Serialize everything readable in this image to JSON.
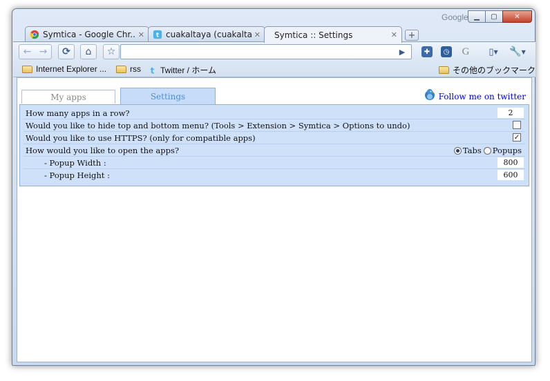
{
  "window": {
    "brand": "Google"
  },
  "tabs": [
    {
      "title": "Symtica - Google Chr...",
      "icon": "chrome-icon"
    },
    {
      "title": "cuakaltaya (cuakaltay...",
      "icon": "twitter-icon"
    },
    {
      "title": "Symtica :: Settings",
      "icon": "none",
      "active": true
    }
  ],
  "omnibox": {
    "value": ""
  },
  "bookmarks": {
    "items": [
      "Internet Explorer ...",
      "rss",
      "Twitter / ホーム"
    ],
    "other": "その他のブックマーク"
  },
  "page": {
    "tabs": {
      "my_apps": "My apps",
      "settings": "Settings"
    },
    "twitter_link": "Follow me on twitter",
    "settings": {
      "apps_per_row": {
        "label": "How many apps in a row?",
        "value": "2"
      },
      "hide_menu": {
        "label": "Would you like to hide top and bottom menu? (Tools > Extension > Symtica > Options to undo)",
        "checked": false
      },
      "use_https": {
        "label": "Would you like to use HTTPS? (only for compatible apps)",
        "checked": true
      },
      "open_apps": {
        "label": "How would you like to open the apps?",
        "options": [
          "Tabs",
          "Popups"
        ],
        "selected": "Tabs"
      },
      "popup_width": {
        "label": "- Popup Width :",
        "value": "800"
      },
      "popup_height": {
        "label": "- Popup Height :",
        "value": "600"
      }
    }
  },
  "colors": {
    "panel": "#cfe0f9",
    "active_tab": "#c6dcf8",
    "link": "#0000ee"
  }
}
